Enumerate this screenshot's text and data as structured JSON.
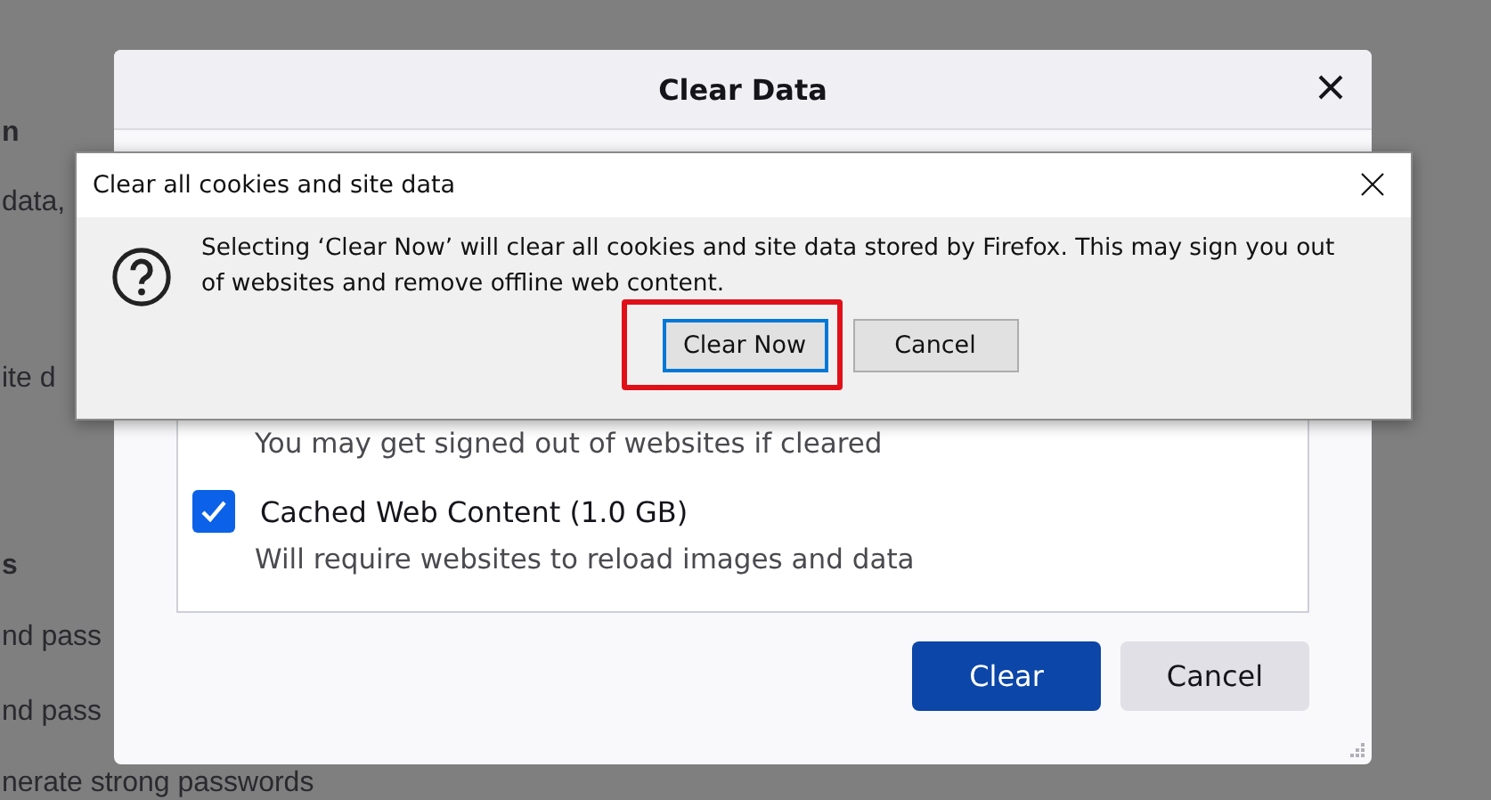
{
  "background_page": [
    {
      "text": "n",
      "bold": true
    },
    {
      "text": "data,",
      "bold": false
    },
    {
      "text": "ite d",
      "bold": false
    },
    {
      "text": "s",
      "bold": true
    },
    {
      "text": "nd pass",
      "bold": false
    },
    {
      "text": "nd pass",
      "bold": false
    },
    {
      "text": "nerate strong passwords",
      "bold": false
    }
  ],
  "clear_data_dialog": {
    "title": "Clear Data",
    "options": [
      {
        "label": "You may get signed out of websites if cleared",
        "kind": "note"
      },
      {
        "label": "Cached Web Content (1.0 GB)",
        "kind": "checkbox",
        "checked": true
      },
      {
        "label": "Will require websites to reload images and data",
        "kind": "note"
      }
    ],
    "buttons": [
      {
        "label": "Clear",
        "primary": true
      },
      {
        "label": "Cancel",
        "primary": false
      }
    ]
  },
  "confirm_dialog": {
    "title": "Clear all cookies and site data",
    "message": "Selecting ‘Clear Now’ will clear all cookies and site data stored by Firefox. This may sign you out of websites and remove offline web content.",
    "buttons": [
      {
        "label": "Clear Now",
        "focused": true,
        "highlighted": true
      },
      {
        "label": "Cancel",
        "focused": false,
        "highlighted": false
      }
    ]
  }
}
